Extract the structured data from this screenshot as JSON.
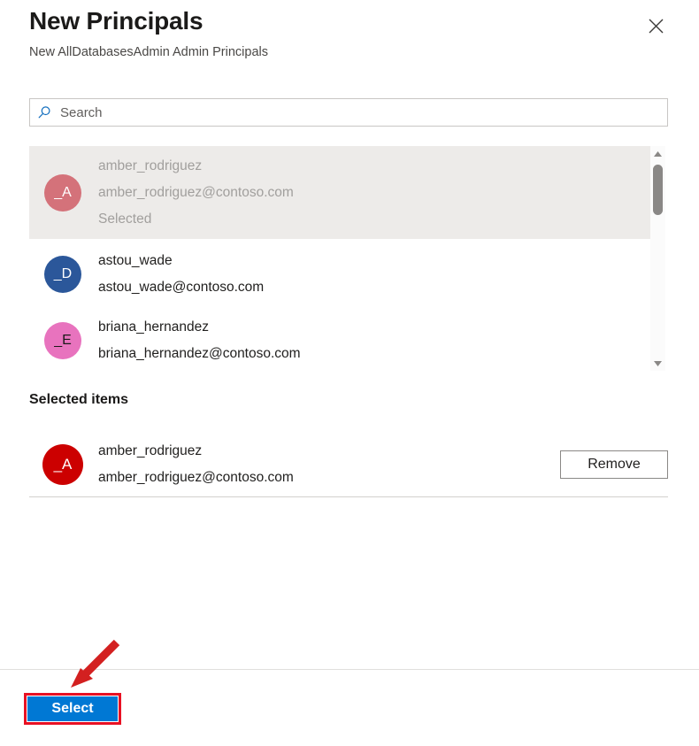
{
  "panel": {
    "title": "New Principals",
    "subtitle": "New AllDatabasesAdmin Admin Principals",
    "close_icon": "close-icon"
  },
  "search": {
    "placeholder": "Search",
    "value": "",
    "icon": "search-icon"
  },
  "results": {
    "rows": [
      {
        "initials": "_A",
        "avatar_color": "#d4727a",
        "name": "amber_rodriguez",
        "email": "amber_rodriguez@contoso.com",
        "state": "Selected",
        "selected": true
      },
      {
        "initials": "_D",
        "avatar_color": "#2b579a",
        "name": "astou_wade",
        "email": "astou_wade@contoso.com",
        "state": "",
        "selected": false
      },
      {
        "initials": "_E",
        "avatar_color": "#e873be",
        "name": "briana_hernandez",
        "email": "briana_hernandez@contoso.com",
        "state": "",
        "selected": false
      }
    ],
    "scrollbar": {
      "up_icon": "triangle-up-icon",
      "down_icon": "triangle-down-icon"
    }
  },
  "selected_items": {
    "heading": "Selected items",
    "items": [
      {
        "initials": "_A",
        "avatar_color": "#cc0000",
        "name": "amber_rodriguez",
        "email": "amber_rodriguez@contoso.com",
        "remove_label": "Remove"
      }
    ]
  },
  "footer": {
    "select_label": "Select"
  },
  "annotation": {
    "color": "#e81123",
    "arrow_icon": "pointer-arrow-icon",
    "highlight_target": "select-button"
  }
}
